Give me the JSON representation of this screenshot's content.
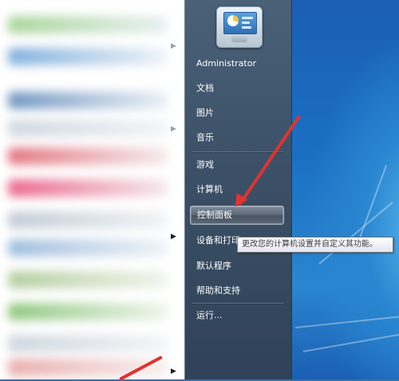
{
  "start_menu": {
    "user_name": "Administrator",
    "items": [
      {
        "label": "文档"
      },
      {
        "label": "图片"
      },
      {
        "label": "音乐"
      },
      {
        "label": "游戏"
      },
      {
        "label": "计算机"
      },
      {
        "label": "控制面板"
      },
      {
        "label": "设备和打印"
      },
      {
        "label": "默认程序"
      },
      {
        "label": "帮助和支持"
      },
      {
        "label": "运行..."
      }
    ],
    "hovered_item": "控制面板",
    "tooltip": "更改您的计算机设置并自定义其功能。"
  },
  "icons": {
    "user_picture": "control-panel-picture-icon",
    "submenu_arrow": "chevron-right-icon",
    "annotation": "red-arrow-annotation"
  },
  "colors": {
    "menu_right_bg": "#3b5066",
    "annotation_red": "#e0332e",
    "desktop_blue": "#2a86d0"
  }
}
